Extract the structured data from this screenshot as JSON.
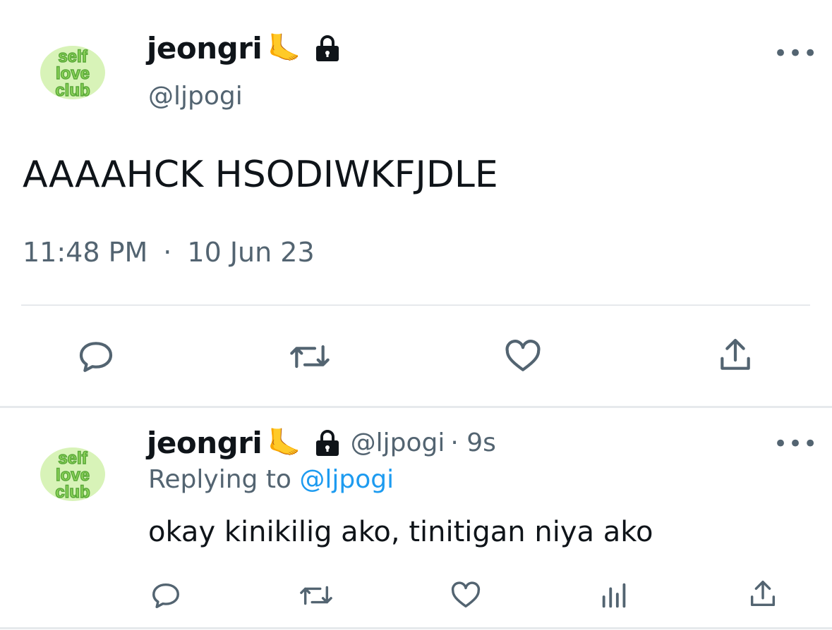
{
  "main_tweet": {
    "author": {
      "display_name": "jeongri",
      "name_emoji": "🦶",
      "handle": "@ljpogi",
      "avatar_text": [
        "self",
        "love",
        "club"
      ],
      "protected_icon": "lock-icon"
    },
    "text": "AAAAHCK HSODIWKFJDLE",
    "time": "11:48 PM",
    "separator": "·",
    "date": "10 Jun 23",
    "actions": [
      "reply-icon",
      "retweet-icon",
      "like-icon",
      "share-icon"
    ],
    "more_label": "•••"
  },
  "reply_tweet": {
    "author": {
      "display_name": "jeongri",
      "name_emoji": "🦶",
      "handle": "@ljpogi",
      "age": "· 9s",
      "avatar_text": [
        "self",
        "love",
        "club"
      ],
      "protected_icon": "lock-icon"
    },
    "replying_label": "Replying to",
    "replying_handle": "@ljpogi",
    "text": "okay kinikilig ako, tinitigan niya ako",
    "actions": [
      "reply-icon",
      "retweet-icon",
      "like-icon",
      "views-icon",
      "share-icon"
    ],
    "more_label": "•••"
  },
  "colors": {
    "text": "#0f1419",
    "muted": "#536471",
    "link": "#1d9bf0",
    "avatar_fill": "#8fd65a",
    "avatar_stroke": "#5aa83a"
  }
}
